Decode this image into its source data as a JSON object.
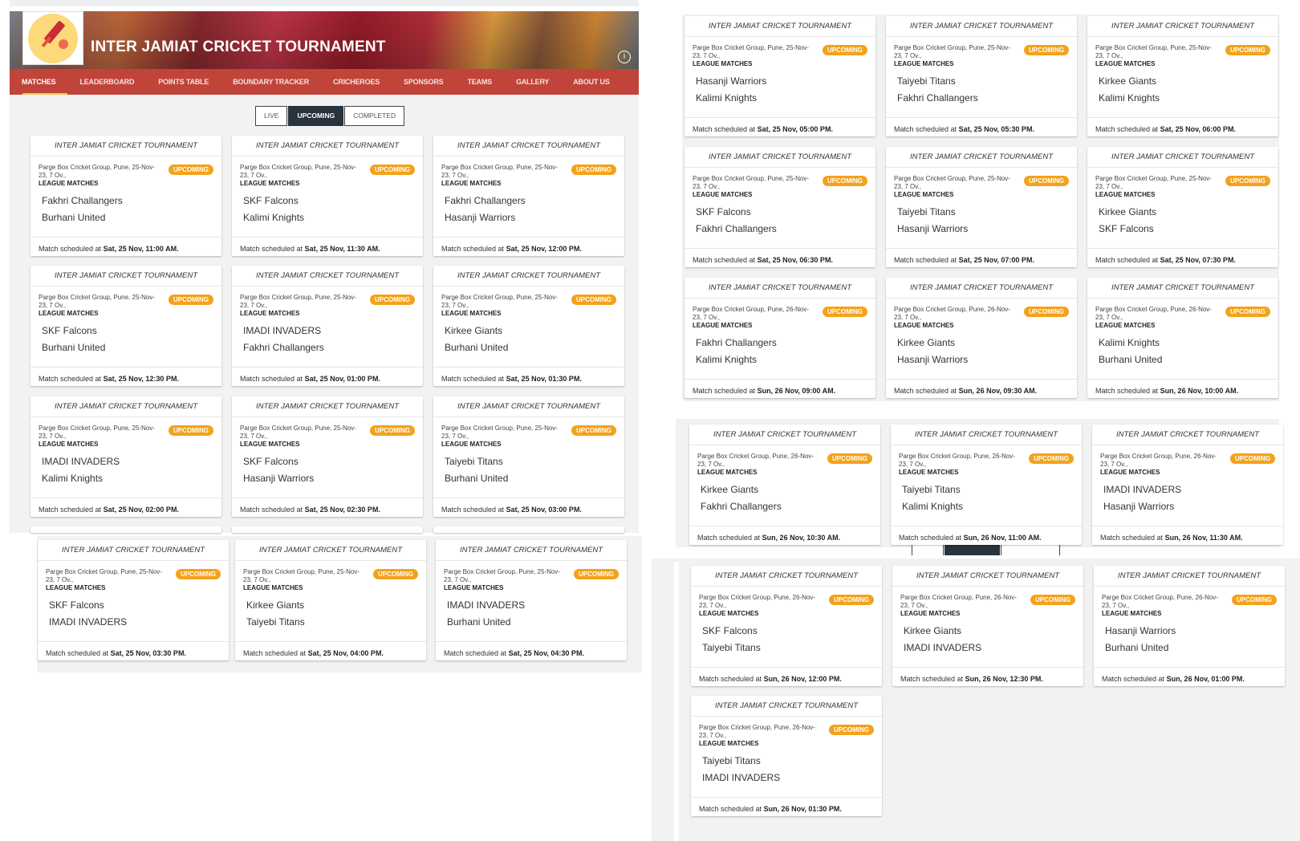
{
  "header": {
    "title": "INTER JAMIAT CRICKET TOURNAMENT",
    "info_icon": "info-circle-icon",
    "logo_icon": "cricket-bat-ball-icon"
  },
  "nav": {
    "items": [
      {
        "label": "MATCHES",
        "active": true
      },
      {
        "label": "LEADERBOARD"
      },
      {
        "label": "POINTS TABLE"
      },
      {
        "label": "BOUNDARY TRACKER"
      },
      {
        "label": "CRICHEROES"
      },
      {
        "label": "SPONSORS"
      },
      {
        "label": "TEAMS"
      },
      {
        "label": "GALLERY"
      },
      {
        "label": "ABOUT US"
      }
    ]
  },
  "toggle": {
    "live": "LIVE",
    "upcoming": "UPCOMING",
    "completed": "COMPLETED",
    "selected": "UPCOMING"
  },
  "card_common": {
    "tournament": "INTER JAMIAT CRICKET TOURNAMENT",
    "status": "UPCOMING",
    "league": "LEAGUE MATCHES",
    "schedule_prefix": "Match scheduled at "
  },
  "matches": [
    {
      "venue": "Parge Box Cricket Group, Pune, 25-Nov-23, 7 Ov.,",
      "team1": "Fakhri Challangers",
      "team2": "Burhani United",
      "time": "Sat, 25 Nov, 11:00 AM."
    },
    {
      "venue": "Parge Box Cricket Group, Pune, 25-Nov-23, 7 Ov.,",
      "team1": "SKF Falcons",
      "team2": "Kalimi Knights",
      "time": "Sat, 25 Nov, 11:30 AM."
    },
    {
      "venue": "Parge Box Cricket Group, Pune, 25-Nov-23, 7 Ov.,",
      "team1": "Fakhri Challangers",
      "team2": "Hasanji Warriors",
      "time": "Sat, 25 Nov, 12:00 PM."
    },
    {
      "venue": "Parge Box Cricket Group, Pune, 25-Nov-23, 7 Ov.,",
      "team1": "SKF Falcons",
      "team2": "Burhani United",
      "time": "Sat, 25 Nov, 12:30 PM."
    },
    {
      "venue": "Parge Box Cricket Group, Pune, 25-Nov-23, 7 Ov.,",
      "team1": "IMADI INVADERS",
      "team2": "Fakhri Challangers",
      "time": "Sat, 25 Nov, 01:00 PM."
    },
    {
      "venue": "Parge Box Cricket Group, Pune, 25-Nov-23, 7 Ov.,",
      "team1": "Kirkee Giants",
      "team2": "Burhani United",
      "time": "Sat, 25 Nov, 01:30 PM."
    },
    {
      "venue": "Parge Box Cricket Group, Pune, 25-Nov-23, 7 Ov.,",
      "team1": "IMADI INVADERS",
      "team2": "Kalimi Knights",
      "time": "Sat, 25 Nov, 02:00 PM."
    },
    {
      "venue": "Parge Box Cricket Group, Pune, 25-Nov-23, 7 Ov.,",
      "team1": "SKF Falcons",
      "team2": "Hasanji Warriors",
      "time": "Sat, 25 Nov, 02:30 PM."
    },
    {
      "venue": "Parge Box Cricket Group, Pune, 25-Nov-23, 7 Ov.,",
      "team1": "Taiyebi Titans",
      "team2": "Burhani United",
      "time": "Sat, 25 Nov, 03:00 PM."
    },
    {
      "venue": "Parge Box Cricket Group, Pune, 25-Nov-23, 7 Ov.,",
      "team1": "SKF Falcons",
      "team2": "IMADI INVADERS",
      "time": "Sat, 25 Nov, 03:30 PM."
    },
    {
      "venue": "Parge Box Cricket Group, Pune, 25-Nov-23, 7 Ov.,",
      "team1": "Kirkee Giants",
      "team2": "Taiyebi Titans",
      "time": "Sat, 25 Nov, 04:00 PM."
    },
    {
      "venue": "Parge Box Cricket Group, Pune, 25-Nov-23, 7 Ov.,",
      "team1": "IMADI INVADERS",
      "team2": "Burhani United",
      "time": "Sat, 25 Nov, 04:30 PM."
    },
    {
      "venue": "Parge Box Cricket Group, Pune, 25-Nov-23, 7 Ov.,",
      "team1": "Hasanji Warriors",
      "team2": "Kalimi Knights",
      "time": "Sat, 25 Nov, 05:00 PM."
    },
    {
      "venue": "Parge Box Cricket Group, Pune, 25-Nov-23, 7 Ov.,",
      "team1": "Taiyebi Titans",
      "team2": "Fakhri Challangers",
      "time": "Sat, 25 Nov, 05:30 PM."
    },
    {
      "venue": "Parge Box Cricket Group, Pune, 25-Nov-23, 7 Ov.,",
      "team1": "Kirkee Giants",
      "team2": "Kalimi Knights",
      "time": "Sat, 25 Nov, 06:00 PM."
    },
    {
      "venue": "Parge Box Cricket Group, Pune, 25-Nov-23, 7 Ov.,",
      "team1": "SKF Falcons",
      "team2": "Fakhri Challangers",
      "time": "Sat, 25 Nov, 06:30 PM."
    },
    {
      "venue": "Parge Box Cricket Group, Pune, 25-Nov-23, 7 Ov.,",
      "team1": "Taiyebi Titans",
      "team2": "Hasanji Warriors",
      "time": "Sat, 25 Nov, 07:00 PM."
    },
    {
      "venue": "Parge Box Cricket Group, Pune, 25-Nov-23, 7 Ov.,",
      "team1": "Kirkee Giants",
      "team2": "SKF Falcons",
      "time": "Sat, 25 Nov, 07:30 PM."
    },
    {
      "venue": "Parge Box Cricket Group, Pune, 26-Nov-23, 7 Ov.,",
      "team1": "Fakhri Challangers",
      "team2": "Kalimi Knights",
      "time": "Sun, 26 Nov, 09:00 AM."
    },
    {
      "venue": "Parge Box Cricket Group, Pune, 26-Nov-23, 7 Ov.,",
      "team1": "Kirkee Giants",
      "team2": "Hasanji Warriors",
      "time": "Sun, 26 Nov, 09:30 AM."
    },
    {
      "venue": "Parge Box Cricket Group, Pune, 26-Nov-23, 7 Ov.,",
      "team1": "Kalimi Knights",
      "team2": "Burhani United",
      "time": "Sun, 26 Nov, 10:00 AM."
    },
    {
      "venue": "Parge Box Cricket Group, Pune, 26-Nov-23, 7 Ov.,",
      "team1": "Kirkee Giants",
      "team2": "Fakhri Challangers",
      "time": "Sun, 26 Nov, 10:30 AM."
    },
    {
      "venue": "Parge Box Cricket Group, Pune, 26-Nov-23, 7 Ov.,",
      "team1": "Taiyebi Titans",
      "team2": "Kalimi Knights",
      "time": "Sun, 26 Nov, 11:00 AM."
    },
    {
      "venue": "Parge Box Cricket Group, Pune, 26-Nov-23, 7 Ov.,",
      "team1": "IMADI INVADERS",
      "team2": "Hasanji Warriors",
      "time": "Sun, 26 Nov, 11:30 AM."
    },
    {
      "venue": "Parge Box Cricket Group, Pune, 26-Nov-23, 7 Ov.,",
      "team1": "SKF Falcons",
      "team2": "Taiyebi Titans",
      "time": "Sun, 26 Nov, 12:00 PM."
    },
    {
      "venue": "Parge Box Cricket Group, Pune, 26-Nov-23, 7 Ov.,",
      "team1": "Kirkee Giants",
      "team2": "IMADI INVADERS",
      "time": "Sun, 26 Nov, 12:30 PM."
    },
    {
      "venue": "Parge Box Cricket Group, Pune, 26-Nov-23, 7 Ov.,",
      "team1": "Hasanji Warriors",
      "team2": "Burhani United",
      "time": "Sun, 26 Nov, 01:00 PM."
    },
    {
      "venue": "Parge Box Cricket Group, Pune, 26-Nov-23, 7 Ov.,",
      "team1": "Taiyebi Titans",
      "team2": "IMADI INVADERS",
      "time": "Sun, 26 Nov, 01:30 PM."
    }
  ]
}
